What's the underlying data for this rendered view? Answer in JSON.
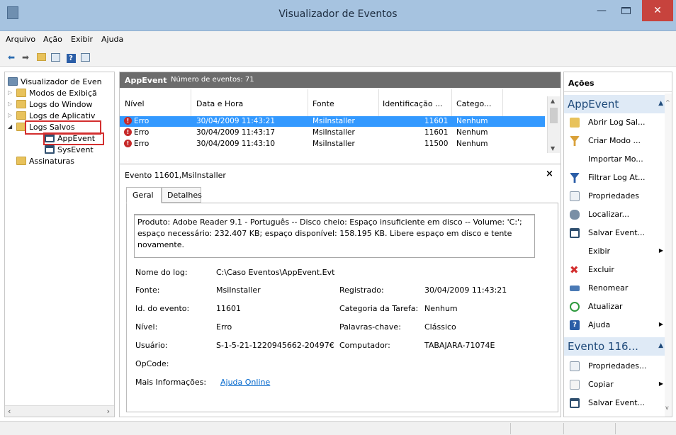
{
  "window": {
    "title": "Visualizador de Eventos",
    "min": "—",
    "close": "✕"
  },
  "menu": [
    "Arquivo",
    "Ação",
    "Exibir",
    "Ajuda"
  ],
  "tree": {
    "root": "Visualizador de Even",
    "items": [
      "Modos de Exibiçã",
      "Logs do Window",
      "Logs de Aplicativ",
      "Logs Salvos",
      "AppEvent",
      "SysEvent",
      "Assinaturas"
    ]
  },
  "center": {
    "header": "AppEvent",
    "count": "Número de eventos: 71",
    "columns": [
      "Nível",
      "Data e Hora",
      "Fonte",
      "Identificação ...",
      "Catego..."
    ],
    "rows": [
      {
        "level": "Erro",
        "date": "30/04/2009 11:43:21",
        "source": "MsiInstaller",
        "id": "11601",
        "cat": "Nenhum"
      },
      {
        "level": "Erro",
        "date": "30/04/2009 11:43:17",
        "source": "MsiInstaller",
        "id": "11601",
        "cat": "Nenhum"
      },
      {
        "level": "Erro",
        "date": "30/04/2009 11:43:10",
        "source": "MsiInstaller",
        "id": "11500",
        "cat": "Nenhum"
      }
    ],
    "detail_title": "Evento 11601,MsiInstaller",
    "tabs": [
      "Geral",
      "Detalhes"
    ],
    "description": "Produto: Adobe Reader 9.1 - Português -- Disco cheio: Espaço insuficiente em disco -- Volume: 'C:'; espaço necessário: 232.407 KB; espaço disponível: 158.195 KB. Libere espaço em disco e tente novamente.",
    "fields": {
      "log_name_label": "Nome do log:",
      "log_name": "C:\\Caso Eventos\\AppEvent.Evt",
      "source_label": "Fonte:",
      "source": "MsiInstaller",
      "registered_label": "Registrado:",
      "registered": "30/04/2009 11:43:21",
      "event_id_label": "Id. do evento:",
      "event_id": "11601",
      "task_cat_label": "Categoria da Tarefa:",
      "task_cat": "Nenhum",
      "level_label": "Nível:",
      "level": "Erro",
      "keywords_label": "Palavras-chave:",
      "keywords": "Clássico",
      "user_label": "Usuário:",
      "user": "S-1-5-21-1220945662-20497€",
      "computer_label": "Computador:",
      "computer": "TABAJARA-71074E",
      "opcode_label": "OpCode:",
      "more_info_label": "Mais Informações:",
      "more_info_link": "Ajuda Online"
    }
  },
  "actions": {
    "title": "Ações",
    "section1": "AppEvent",
    "items1": [
      "Abrir Log Sal...",
      "Criar Modo ...",
      "Importar Mo...",
      "Filtrar Log At...",
      "Propriedades",
      "Localizar...",
      "Salvar Event...",
      "Exibir",
      "Excluir",
      "Renomear",
      "Atualizar",
      "Ajuda"
    ],
    "section2": "Evento 116...",
    "items2": [
      "Propriedades...",
      "Copiar",
      "Salvar Event..."
    ]
  },
  "colors": {
    "accent": "#3399ff",
    "error": "#c62828",
    "highlight": "#d32f2f"
  }
}
